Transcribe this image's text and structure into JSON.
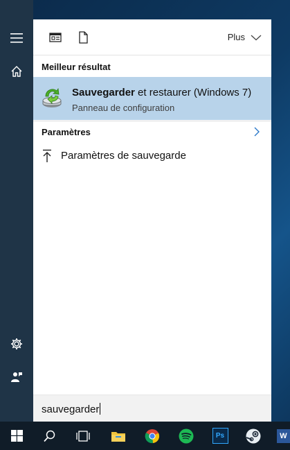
{
  "toolbar": {
    "more_label": "Plus"
  },
  "best_match": {
    "heading": "Meilleur résultat",
    "title_bold": "Sauvegarder",
    "title_rest": " et restaurer (Windows 7)",
    "subtitle": "Panneau de configuration"
  },
  "settings": {
    "heading": "Paramètres",
    "items": [
      {
        "label": "Paramètres de sauvegarde"
      }
    ]
  },
  "search": {
    "value": "sauvegarder"
  },
  "colors": {
    "highlight": "#b8d3ea",
    "rail": "#1f3447",
    "taskbar": "#101c28",
    "accent": "#0078d7"
  },
  "taskbar": {
    "items": [
      "start-icon",
      "search-icon",
      "task-view-icon",
      "file-explorer-icon",
      "chrome-icon",
      "spotify-icon",
      "photoshop-icon",
      "steam-icon",
      "word-icon"
    ],
    "photoshop_text": "Ps",
    "word_text": "W"
  }
}
